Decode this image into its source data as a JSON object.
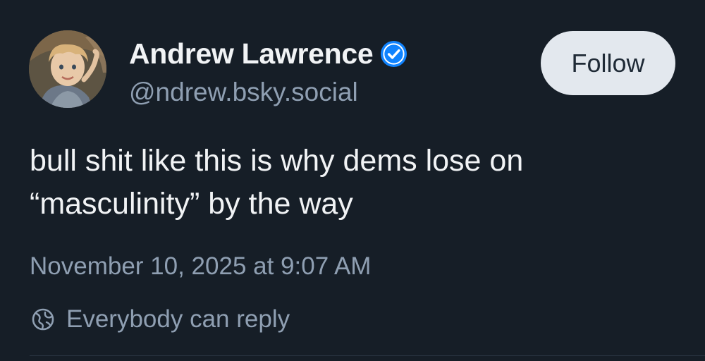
{
  "author": {
    "display_name": "Andrew Lawrence",
    "handle": "@ndrew.bsky.social",
    "verified": true,
    "avatar_icon": "child-photo-avatar"
  },
  "follow_button": {
    "label": "Follow"
  },
  "post": {
    "text_line_1": "bull shit like this is why dems lose on",
    "text_line_2": "“masculinity” by the way",
    "timestamp": "November 10, 2025 at 9:07 AM"
  },
  "reply_settings": {
    "icon": "globe-icon",
    "label": "Everybody can reply"
  },
  "colors": {
    "background": "#161e27",
    "primary_text": "#f1f3f5",
    "secondary_text": "#8f9fb2",
    "verified_blue": "#1083fe",
    "button_bg": "#e3e8ee"
  }
}
